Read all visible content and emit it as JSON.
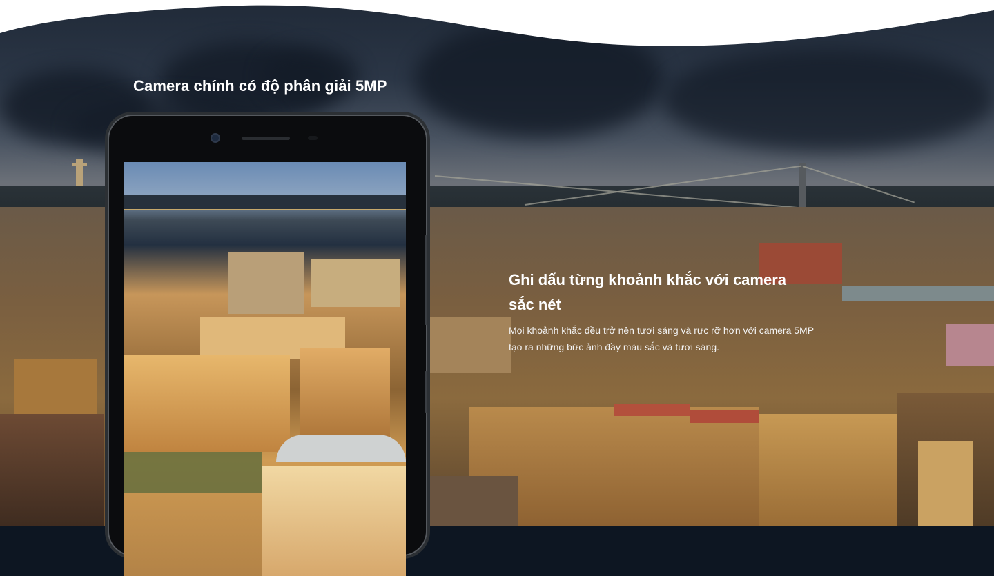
{
  "section": {
    "camera_caption": "Camera chính có độ phân giải 5MP",
    "headline": "Ghi dấu từng khoảnh khắc với camera sắc nét",
    "description": "Mọi khoảnh khắc đều trở nên tươi sáng và rực rỡ hơn với camera 5MP tạo ra những bức ảnh đầy màu sắc và tươi sáng."
  },
  "colors": {
    "text": "#ffffff",
    "page_background": "#ffffff",
    "phone_frame": "#2c3034"
  },
  "icons": [
    "front-camera-icon",
    "earpiece-speaker-icon"
  ]
}
